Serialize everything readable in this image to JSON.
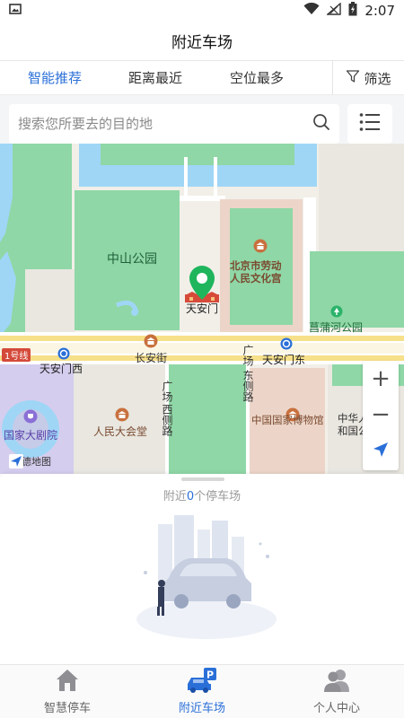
{
  "status_bar": {
    "time": "2:07"
  },
  "header": {
    "title": "附近车场"
  },
  "sort_tabs": [
    {
      "label": "智能推荐",
      "active": true
    },
    {
      "label": "距离最近",
      "active": false
    },
    {
      "label": "空位最多",
      "active": false
    }
  ],
  "filter": {
    "label": "筛选"
  },
  "search": {
    "placeholder": "搜索您所要去的目的地"
  },
  "map": {
    "labels": {
      "zhongshan_park": "中山公园",
      "workers_palace": "北京市劳动人民文化宫",
      "workers_palace_line1": "北京市劳动",
      "workers_palace_line2": "人民文化宫",
      "tiananmen": "天安门",
      "changpu_park": "菖蒲河公园",
      "line1": "1号线",
      "tiananmen_west": "天安门西",
      "changan_street": "长安街",
      "tiananmen_east": "天安门东",
      "square_east_line1": "广场",
      "square_east_line2": "东侧路",
      "square_west_line1": "广场",
      "square_west_line2": "西侧路",
      "national_theater": "国家大剧院",
      "great_hall": "人民大会堂",
      "national_museum": "中国国家博物馆",
      "zhonghua_line1": "中华人",
      "zhonghua_line2": "和国公",
      "provider": "高德地图"
    }
  },
  "zoom": {
    "in": "+",
    "out": "−"
  },
  "sheet": {
    "prefix": "附近",
    "count": "0",
    "suffix": "个停车场"
  },
  "bottom_nav": [
    {
      "label": "智慧停车",
      "active": false
    },
    {
      "label": "附近车场",
      "active": true
    },
    {
      "label": "个人中心",
      "active": false
    }
  ],
  "colors": {
    "accent": "#2a6fd8",
    "park_green": "#8fd7a6",
    "water": "#9fd6f6",
    "road_yellow": "#f7e08a",
    "pin_green": "#1fb55c"
  }
}
